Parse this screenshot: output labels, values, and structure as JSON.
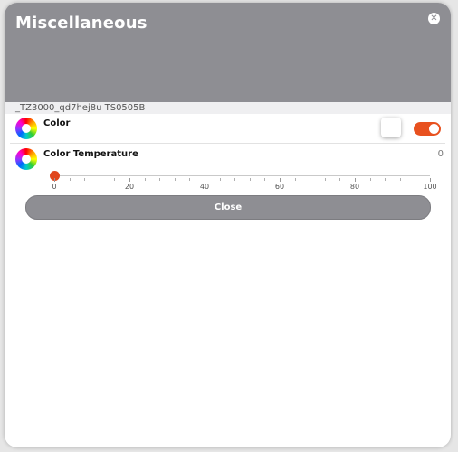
{
  "dialog": {
    "title": "Miscellaneous",
    "close_icon": "close-icon",
    "device_label": "_TZ3000_qd7hej8u TS0505B",
    "colors": {
      "header": "#8e8e93",
      "accent": "#e8511f"
    }
  },
  "rows": [
    {
      "label": "Color",
      "icon": "color-wheel-icon",
      "toggle_on": true
    },
    {
      "label": "Color Temperature",
      "icon": "color-wheel-icon",
      "value": "0",
      "slider": {
        "min": 0,
        "max": 100,
        "value": 0,
        "tick_labels": [
          "0",
          "20",
          "40",
          "60",
          "80",
          "100"
        ]
      }
    }
  ],
  "footer": {
    "close_label": "Close"
  }
}
